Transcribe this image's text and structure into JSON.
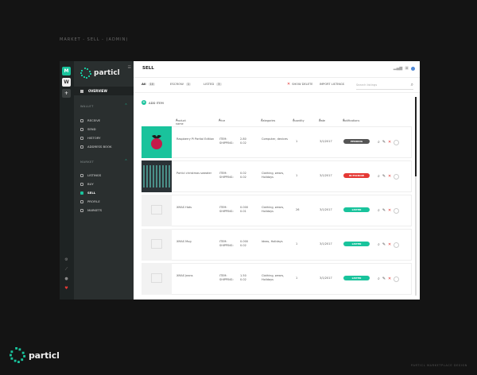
{
  "page_caption": "MARKET - SELL - (ADMIN)",
  "footer": {
    "brand": "particl",
    "credit": "PARTICL MARKETPLACE DESIGN"
  },
  "rail": {
    "buttons": [
      "M",
      "W",
      "+"
    ]
  },
  "brand": {
    "name": "particl"
  },
  "sidebar": {
    "overview": "OVERVIEW",
    "wallet_title": "WALLET",
    "wallet_items": [
      "RECEIVE",
      "SEND",
      "HISTORY",
      "ADDRESS BOOK"
    ],
    "market_title": "MARKET",
    "market_items": [
      "LISTINGS",
      "BUY",
      "SELL",
      "PROFILE",
      "MARKETS"
    ]
  },
  "topbar": {
    "title": "SELL"
  },
  "tabs": [
    {
      "label": "All",
      "count": "10"
    },
    {
      "label": "ESCROW",
      "count": "1"
    },
    {
      "label": "LISTED",
      "count": "3"
    }
  ],
  "tab_links": {
    "delete": "SHOW DELETE",
    "import": "IMPORT LISTINGS"
  },
  "search": {
    "placeholder": "Search listings"
  },
  "add_item": "ADD ITEM",
  "table": {
    "headers": {
      "name": "Product name",
      "price": "Price",
      "category": "Categories",
      "quantity": "Quantity",
      "date": "Date",
      "notifications": "Notifications"
    },
    "rows": [
      {
        "name": "Raspberry Pi Partial Edition",
        "item_label": "ITEM:",
        "item_price": "2.80",
        "ship_label": "SHIPPING:",
        "ship_price": "0.02",
        "category": "Computer, devices",
        "quantity": "1",
        "date": "3/1/2017",
        "status": "PENDING",
        "status_color": "#555555"
      },
      {
        "name": "Particl christmas sweater",
        "item_label": "ITEM:",
        "item_price": "0.02",
        "ship_label": "SHIPPING:",
        "ship_price": "0.02",
        "category": "Clothing, wears, Holidays",
        "quantity": "1",
        "date": "3/1/2017",
        "status": "IN ESCROW",
        "status_color": "#e53935"
      },
      {
        "name": "XMAS Hats",
        "item_label": "ITEM:",
        "item_price": "0.000",
        "ship_label": "SHIPPING:",
        "ship_price": "0.01",
        "category": "Clothing, wears, Holidays",
        "quantity": "26",
        "date": "3/1/2017",
        "status": "LISTED",
        "status_color": "#19c39c"
      },
      {
        "name": "XMAS Mug",
        "item_label": "ITEM:",
        "item_price": "0.000",
        "ship_label": "SHIPPING:",
        "ship_price": "0.02",
        "category": "Ideas, Holidays",
        "quantity": "1",
        "date": "3/1/2017",
        "status": "LISTED",
        "status_color": "#19c39c"
      },
      {
        "name": "XMAS Jeans",
        "item_label": "ITEM:",
        "item_price": "1.50",
        "ship_label": "SHIPPING:",
        "ship_price": "0.02",
        "category": "Clothing, wears, Holidays",
        "quantity": "1",
        "date": "3/1/2017",
        "status": "LISTED",
        "status_color": "#19c39c"
      }
    ]
  },
  "colors": {
    "accent": "#19c39c",
    "danger": "#e53935",
    "sidebar": "#2a2f2f"
  }
}
